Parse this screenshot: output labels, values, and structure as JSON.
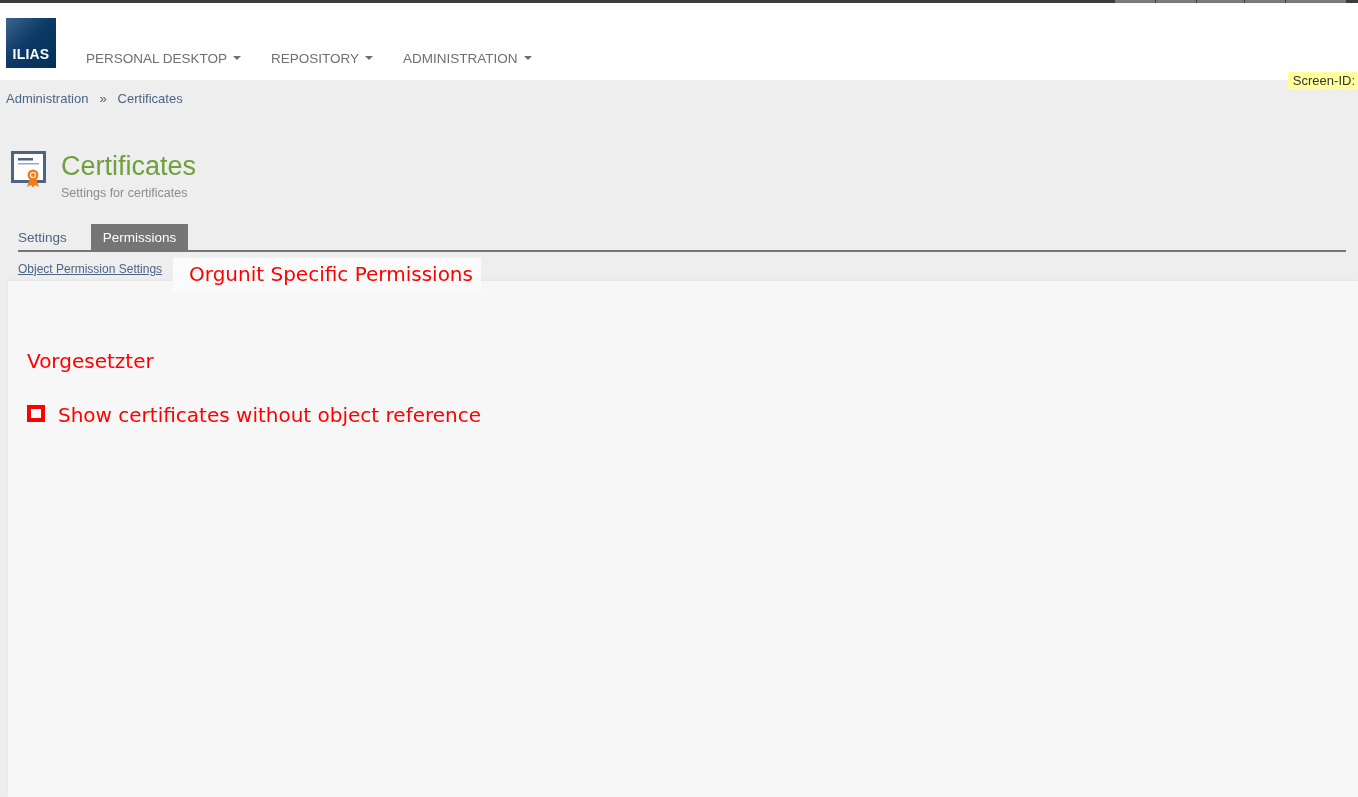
{
  "header": {
    "logo": "ILIAS",
    "nav": [
      {
        "label": "PERSONAL DESKTOP"
      },
      {
        "label": "REPOSITORY"
      },
      {
        "label": "ADMINISTRATION"
      }
    ]
  },
  "screen_id": "Screen-ID:",
  "breadcrumb": {
    "items": [
      "Administration",
      "Certificates"
    ],
    "separator": "»"
  },
  "page": {
    "title": "Certificates",
    "subtitle": "Settings for certificates"
  },
  "tabs": [
    {
      "label": "Settings",
      "selected": false
    },
    {
      "label": "Permissions",
      "selected": true
    }
  ],
  "subtabs": [
    {
      "label": "Object Permission Settings"
    }
  ],
  "annotation": {
    "title": "Orgunit Specific Permissions",
    "section": "Vorgesetzter",
    "checkbox": {
      "label": "Show certificates without object reference",
      "checked": false
    }
  }
}
